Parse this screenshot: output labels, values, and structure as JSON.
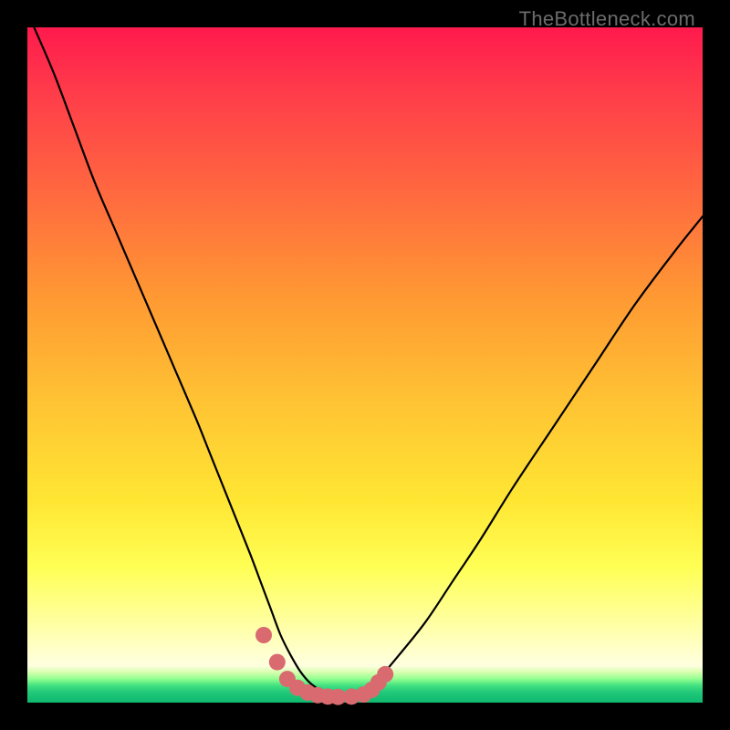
{
  "watermark": {
    "text": "TheBottleneck.com"
  },
  "palette": {
    "curve_stroke": "#000000",
    "marker_fill": "#d96a6f",
    "marker_stroke": "#c75a5f"
  },
  "chart_data": {
    "type": "line",
    "title": "",
    "xlabel": "",
    "ylabel": "",
    "xlim": [
      0,
      100
    ],
    "ylim": [
      0,
      100
    ],
    "grid": false,
    "curve": {
      "x": [
        1,
        4,
        7,
        10,
        13,
        16,
        19,
        22,
        25,
        27,
        29,
        31,
        33,
        34.5,
        36,
        37.5,
        39,
        40.5,
        42,
        44,
        46,
        48,
        50,
        52,
        55,
        59,
        63,
        67,
        72,
        78,
        84,
        90,
        96,
        100
      ],
      "y": [
        100,
        93,
        85,
        77,
        70,
        63,
        56,
        49,
        42,
        37,
        32,
        27,
        22,
        18,
        14,
        10,
        7,
        4.5,
        2.8,
        1.5,
        0.7,
        0.8,
        1.7,
        3.5,
        7,
        12,
        18,
        24,
        32,
        41,
        50,
        59,
        67,
        72
      ]
    },
    "markers": {
      "x": [
        35,
        37,
        38.5,
        40,
        41.5,
        43,
        44.5,
        46,
        48,
        49.8,
        51,
        52,
        53
      ],
      "y": [
        10.0,
        6.0,
        3.5,
        2.2,
        1.5,
        1.1,
        0.9,
        0.85,
        0.9,
        1.2,
        1.9,
        3.0,
        4.2
      ]
    }
  }
}
